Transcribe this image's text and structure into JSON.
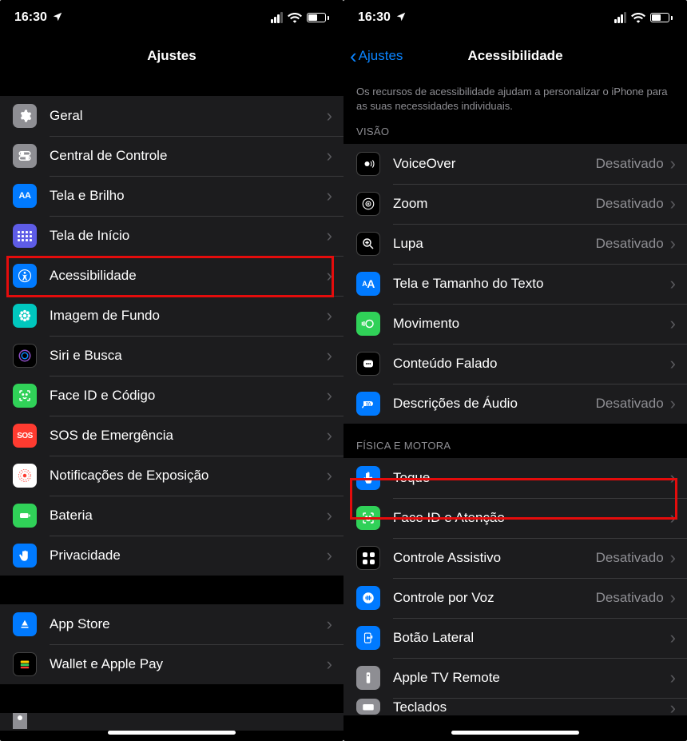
{
  "status": {
    "time": "16:30"
  },
  "left": {
    "title": "Ajustes",
    "rows": [
      {
        "id": "general",
        "label": "Geral",
        "icon": "gear-icon",
        "color": "ic-gray"
      },
      {
        "id": "controlcenter",
        "label": "Central de Controle",
        "icon": "toggles-icon",
        "color": "ic-gray"
      },
      {
        "id": "display",
        "label": "Tela e Brilho",
        "icon": "aa-icon",
        "color": "ic-blue"
      },
      {
        "id": "home",
        "label": "Tela de Início",
        "icon": "grid-icon",
        "color": "ic-indigo"
      },
      {
        "id": "accessibility",
        "label": "Acessibilidade",
        "icon": "accessibility-icon",
        "color": "ic-blue",
        "highlight": true
      },
      {
        "id": "wallpaper",
        "label": "Imagem de Fundo",
        "icon": "flower-icon",
        "color": "ic-teal"
      },
      {
        "id": "siri",
        "label": "Siri e Busca",
        "icon": "siri-icon",
        "color": "ic-black"
      },
      {
        "id": "faceid",
        "label": "Face ID e Código",
        "icon": "face-icon",
        "color": "ic-green"
      },
      {
        "id": "sos",
        "label": "SOS de Emergência",
        "icon": "sos-icon",
        "color": "ic-red"
      },
      {
        "id": "exposure",
        "label": "Notificações de Exposição",
        "icon": "exposure-icon",
        "color": "ic-white"
      },
      {
        "id": "battery",
        "label": "Bateria",
        "icon": "battery-icon",
        "color": "ic-green"
      },
      {
        "id": "privacy",
        "label": "Privacidade",
        "icon": "hand-icon",
        "color": "ic-blue"
      }
    ],
    "rows2": [
      {
        "id": "appstore",
        "label": "App Store",
        "icon": "appstore-icon",
        "color": "ic-blue"
      },
      {
        "id": "wallet",
        "label": "Wallet e Apple Pay",
        "icon": "wallet-icon",
        "color": "ic-black"
      }
    ]
  },
  "right": {
    "back": "Ajustes",
    "title": "Acessibilidade",
    "intro": "Os recursos de acessibilidade ajudam a personalizar o iPhone para as suas necessidades individuais.",
    "section1": "VISÃO",
    "rows1": [
      {
        "id": "voiceover",
        "label": "VoiceOver",
        "value": "Desativado",
        "icon": "voiceover-icon",
        "color": "ic-black"
      },
      {
        "id": "zoom",
        "label": "Zoom",
        "value": "Desativado",
        "icon": "zoom-icon",
        "color": "ic-black"
      },
      {
        "id": "magnifier",
        "label": "Lupa",
        "value": "Desativado",
        "icon": "magnifier-icon",
        "color": "ic-black"
      },
      {
        "id": "textsize",
        "label": "Tela e Tamanho do Texto",
        "icon": "aa-icon",
        "color": "ic-blue"
      },
      {
        "id": "motion",
        "label": "Movimento",
        "icon": "motion-icon",
        "color": "ic-green"
      },
      {
        "id": "spoken",
        "label": "Conteúdo Falado",
        "icon": "spoken-icon",
        "color": "ic-black"
      },
      {
        "id": "audiodesc",
        "label": "Descrições de Áudio",
        "value": "Desativado",
        "icon": "audiodesc-icon",
        "color": "ic-blue"
      }
    ],
    "section2": "FÍSICA E MOTORA",
    "rows2": [
      {
        "id": "touch",
        "label": "Toque",
        "icon": "touch-icon",
        "color": "ic-blue",
        "highlight": true
      },
      {
        "id": "faceattn",
        "label": "Face ID e Atenção",
        "icon": "face-icon",
        "color": "ic-green"
      },
      {
        "id": "switch",
        "label": "Controle Assistivo",
        "value": "Desativado",
        "icon": "switch-icon",
        "color": "ic-black"
      },
      {
        "id": "voice",
        "label": "Controle por Voz",
        "value": "Desativado",
        "icon": "voice-icon",
        "color": "ic-blue"
      },
      {
        "id": "sidebutton",
        "label": "Botão Lateral",
        "icon": "sidebutton-icon",
        "color": "ic-blue"
      },
      {
        "id": "appletv",
        "label": "Apple TV Remote",
        "icon": "remote-icon",
        "color": "ic-gray"
      },
      {
        "id": "keyboards",
        "label": "Teclados",
        "icon": "keyboard-icon",
        "color": "ic-gray"
      }
    ]
  }
}
